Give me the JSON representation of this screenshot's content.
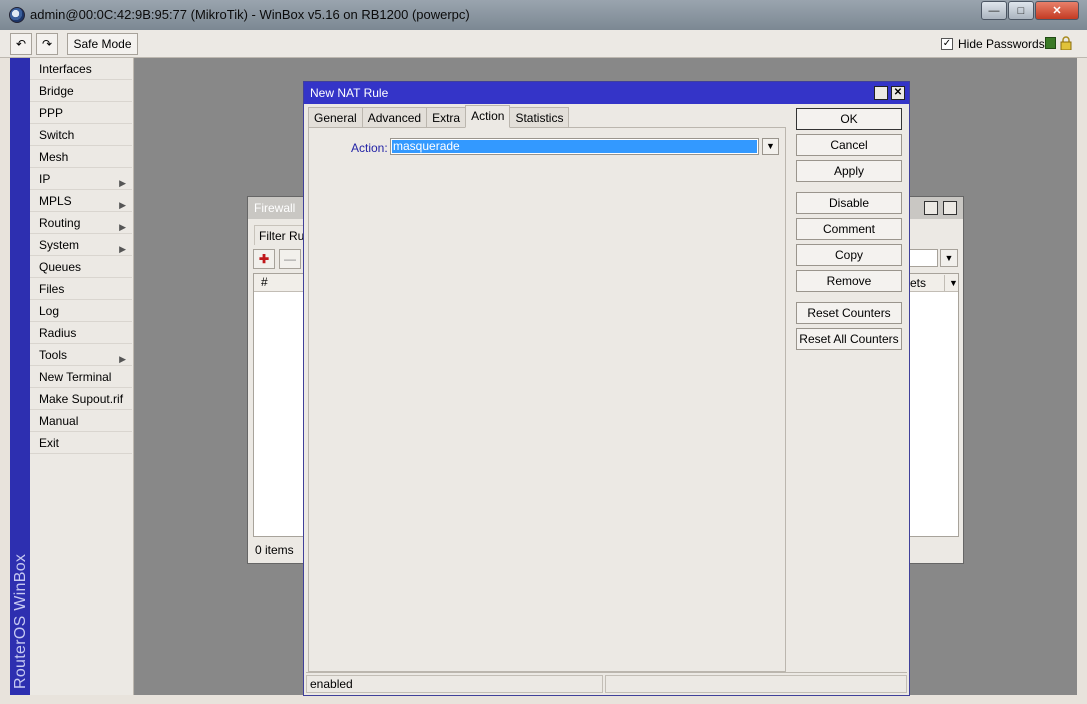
{
  "window": {
    "title": "admin@00:0C:42:9B:95:77 (MikroTik) - WinBox v5.16 on RB1200 (powerpc)",
    "minimize": "—",
    "maximize": "□",
    "close": "✕"
  },
  "toolbar": {
    "undo_icon": "↶",
    "redo_icon": "↷",
    "safe_mode": "Safe Mode",
    "hide_passwords": "Hide Passwords",
    "hide_passwords_checked": "✓"
  },
  "sidebar": {
    "brand": "RouterOS WinBox",
    "items": [
      {
        "label": "Interfaces"
      },
      {
        "label": "Bridge"
      },
      {
        "label": "PPP"
      },
      {
        "label": "Switch"
      },
      {
        "label": "Mesh"
      },
      {
        "label": "IP",
        "arrow": "▶"
      },
      {
        "label": "MPLS",
        "arrow": "▶"
      },
      {
        "label": "Routing",
        "arrow": "▶"
      },
      {
        "label": "System",
        "arrow": "▶"
      },
      {
        "label": "Queues"
      },
      {
        "label": "Files"
      },
      {
        "label": "Log"
      },
      {
        "label": "Radius"
      },
      {
        "label": "Tools",
        "arrow": "▶"
      },
      {
        "label": "New Terminal"
      },
      {
        "label": "Make Supout.rif"
      },
      {
        "label": "Manual"
      },
      {
        "label": "Exit"
      }
    ]
  },
  "firewall": {
    "title": "Firewall",
    "tab": "Filter Rule",
    "add_icon": "✚",
    "remove_icon": "—",
    "col_num": "#",
    "col_right": "ets",
    "col_menu": "▼",
    "filter_menu": "▼",
    "items": "0 items"
  },
  "dialog": {
    "title": "New NAT Rule",
    "tabs": [
      "General",
      "Advanced",
      "Extra",
      "Action",
      "Statistics"
    ],
    "action_label": "Action:",
    "action_value": "masquerade",
    "dropdown_icon": "▼",
    "buttons": {
      "ok": "OK",
      "cancel": "Cancel",
      "apply": "Apply",
      "disable": "Disable",
      "comment": "Comment",
      "copy": "Copy",
      "remove": "Remove",
      "reset_counters": "Reset Counters",
      "reset_all_counters": "Reset All Counters"
    },
    "status": "enabled"
  }
}
